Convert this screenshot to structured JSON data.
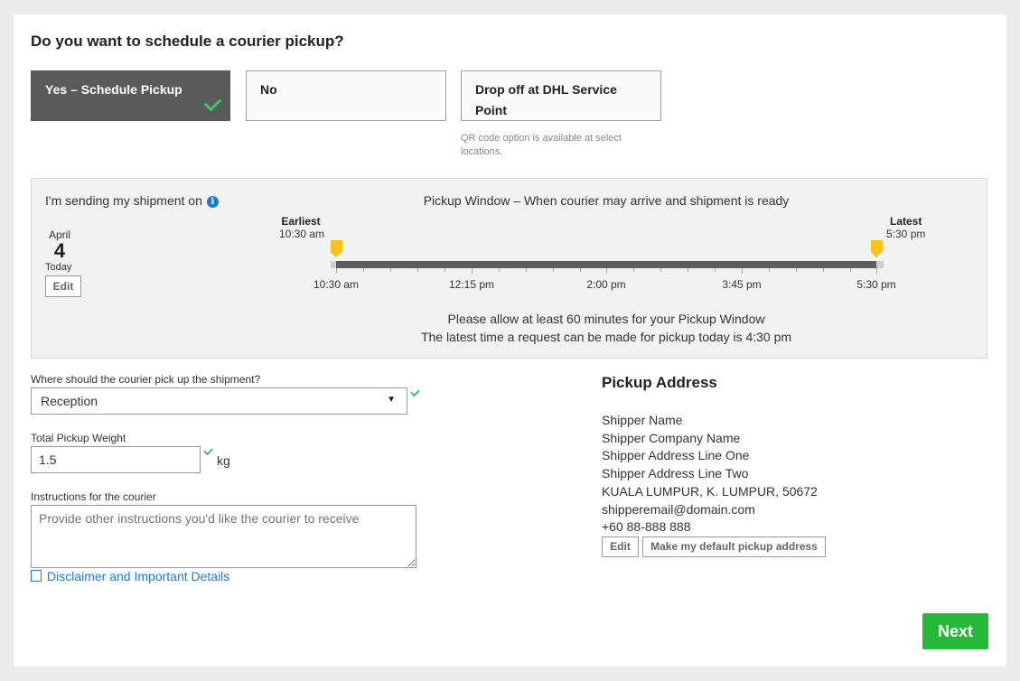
{
  "question": "Do you want to schedule a courier pickup?",
  "options": [
    {
      "label": "Yes – Schedule Pickup",
      "selected": true
    },
    {
      "label": "No",
      "selected": false
    },
    {
      "label": "Drop off at DHL Service Point",
      "selected": false
    }
  ],
  "dropoff_hint": "QR code option is available at select locations.",
  "schedule": {
    "sending_label": "I'm sending my shipment on",
    "month": "April",
    "day": "4",
    "day_note": "Today",
    "edit_label": "Edit",
    "window_title": "Pickup Window – When courier may arrive and shipment is ready",
    "earliest_label": "Earliest",
    "earliest_time": "10:30 am",
    "latest_label": "Latest",
    "latest_time": "5:30 pm",
    "ticks": [
      "10:30 am",
      "12:15 pm",
      "2:00 pm",
      "3:45 pm",
      "5:30 pm"
    ],
    "note_1": "Please allow at least 60 minutes for your Pickup Window",
    "note_2": "The latest time a request can be made for pickup today is 4:30 pm"
  },
  "form": {
    "location_label": "Where should the courier pick up the shipment?",
    "location_value": "Reception",
    "weight_label": "Total Pickup Weight",
    "weight_value": "1.5",
    "weight_unit": "kg",
    "instructions_label": "Instructions for the courier",
    "instructions_placeholder": "Provide other instructions you'd like the courier to receive",
    "disclaimer_link": "Disclaimer and Important Details"
  },
  "address": {
    "title": "Pickup Address",
    "lines": [
      "Shipper Name",
      "Shipper Company Name",
      "Shipper Address Line One",
      "Shipper Address Line Two",
      "KUALA LUMPUR, K. LUMPUR, 50672",
      "shipperemail@domain.com",
      "+60 88-888 888"
    ],
    "edit_label": "Edit",
    "default_label": "Make my default pickup address"
  },
  "next_label": "Next",
  "colors": {
    "accent_green": "#26b839",
    "selected_bg": "#5a5a5a",
    "marker": "#f8c11b",
    "link": "#1a7bd0"
  }
}
